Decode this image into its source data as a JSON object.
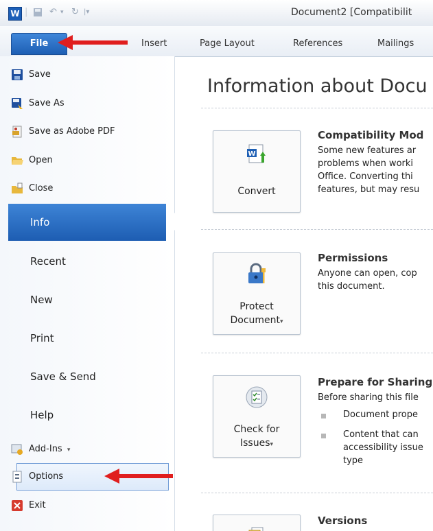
{
  "title": "Document2 [Compatibilit",
  "tabs": {
    "file": "File",
    "insert": "Insert",
    "page_layout": "Page Layout",
    "references": "References",
    "mailings": "Mailings"
  },
  "sidebar": {
    "save": "Save",
    "save_as": "Save As",
    "save_pdf": "Save as Adobe PDF",
    "open": "Open",
    "close": "Close",
    "info": "Info",
    "recent": "Recent",
    "new": "New",
    "print": "Print",
    "save_send": "Save & Send",
    "help": "Help",
    "add_ins": "Add-Ins",
    "options": "Options",
    "exit": "Exit"
  },
  "main": {
    "heading": "Information about Docu",
    "compat": {
      "button": "Convert",
      "title": "Compatibility Mod",
      "lines": [
        "Some new features ar",
        "problems when worki",
        "Office. Converting thi",
        "features, but may resu"
      ]
    },
    "permissions": {
      "button_line1": "Protect",
      "button_line2": "Document",
      "title": "Permissions",
      "lines": [
        "Anyone can open, cop",
        "this document."
      ]
    },
    "prepare": {
      "button_line1": "Check for",
      "button_line2": "Issues",
      "title": "Prepare for Sharing",
      "intro": "Before sharing this file",
      "bullet1": "Document prope",
      "bullet2_lines": [
        "Content that can",
        "accessibility issue",
        "type"
      ]
    },
    "versions": {
      "title": "Versions"
    }
  },
  "colors": {
    "accent": "#1e5fb4",
    "arrow": "#e01e1e"
  }
}
